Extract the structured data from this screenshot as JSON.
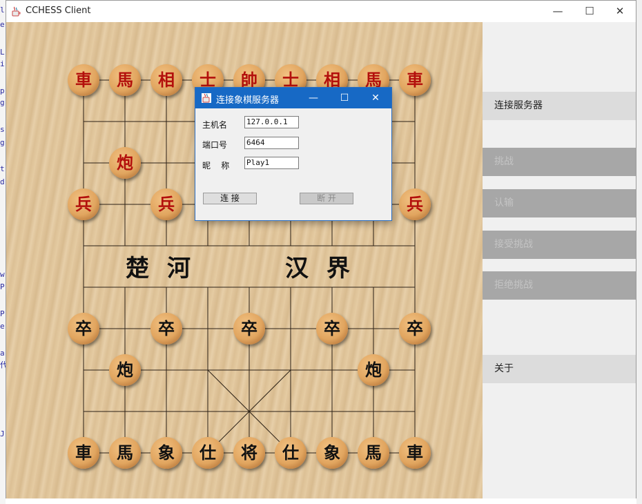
{
  "main_window": {
    "title": "CCHESS Client",
    "minimize": "—",
    "maximize": "☐",
    "close": "✕"
  },
  "editor_strip": [
    "l",
    "e",
    "L",
    "i",
    "p",
    "g",
    "s",
    "g",
    "t",
    "d",
    "w",
    "P",
    "P",
    "e",
    "a",
    "代",
    "J"
  ],
  "board": {
    "river_left": "楚河",
    "river_right": "汉界",
    "pieces": [
      {
        "text": "車",
        "color": "red",
        "col": 0,
        "row": 0
      },
      {
        "text": "馬",
        "color": "red",
        "col": 1,
        "row": 0
      },
      {
        "text": "相",
        "color": "red",
        "col": 2,
        "row": 0
      },
      {
        "text": "士",
        "color": "red",
        "col": 3,
        "row": 0
      },
      {
        "text": "帥",
        "color": "red",
        "col": 4,
        "row": 0
      },
      {
        "text": "士",
        "color": "red",
        "col": 5,
        "row": 0
      },
      {
        "text": "相",
        "color": "red",
        "col": 6,
        "row": 0
      },
      {
        "text": "馬",
        "color": "red",
        "col": 7,
        "row": 0
      },
      {
        "text": "車",
        "color": "red",
        "col": 8,
        "row": 0
      },
      {
        "text": "炮",
        "color": "red",
        "col": 1,
        "row": 2
      },
      {
        "text": "兵",
        "color": "red",
        "col": 0,
        "row": 3
      },
      {
        "text": "兵",
        "color": "red",
        "col": 2,
        "row": 3
      },
      {
        "text": "兵",
        "color": "red",
        "col": 8,
        "row": 3
      },
      {
        "text": "卒",
        "color": "black",
        "col": 0,
        "row": 6
      },
      {
        "text": "卒",
        "color": "black",
        "col": 2,
        "row": 6
      },
      {
        "text": "卒",
        "color": "black",
        "col": 4,
        "row": 6
      },
      {
        "text": "卒",
        "color": "black",
        "col": 6,
        "row": 6
      },
      {
        "text": "卒",
        "color": "black",
        "col": 8,
        "row": 6
      },
      {
        "text": "炮",
        "color": "black",
        "col": 1,
        "row": 7
      },
      {
        "text": "炮",
        "color": "black",
        "col": 7,
        "row": 7
      },
      {
        "text": "車",
        "color": "black",
        "col": 0,
        "row": 9
      },
      {
        "text": "馬",
        "color": "black",
        "col": 1,
        "row": 9
      },
      {
        "text": "象",
        "color": "black",
        "col": 2,
        "row": 9
      },
      {
        "text": "仕",
        "color": "black",
        "col": 3,
        "row": 9
      },
      {
        "text": "将",
        "color": "black",
        "col": 4,
        "row": 9
      },
      {
        "text": "仕",
        "color": "black",
        "col": 5,
        "row": 9
      },
      {
        "text": "象",
        "color": "black",
        "col": 6,
        "row": 9
      },
      {
        "text": "馬",
        "color": "black",
        "col": 7,
        "row": 9
      },
      {
        "text": "車",
        "color": "black",
        "col": 8,
        "row": 9
      }
    ]
  },
  "side_panel": {
    "connect_server": "连接服务器",
    "challenge": "挑战",
    "resign": "认输",
    "accept_challenge": "接受挑战",
    "reject_challenge": "拒绝挑战",
    "about": "关于"
  },
  "dialog": {
    "title": "连接象棋服务器",
    "minimize": "—",
    "maximize": "☐",
    "close": "✕",
    "host_label": "主机名",
    "host_value": "127.0.0.1",
    "port_label": "端口号",
    "port_value": "6464",
    "nickname_label": "昵    称",
    "nickname_value": "Play1",
    "connect_label": "连 接",
    "disconnect_label": "断 开"
  },
  "colors": {
    "dialog_titlebar": "#1769c5",
    "red_piece_text": "#b3100c",
    "black_piece_text": "#111111",
    "disabled_button": "#a7a7a7"
  }
}
